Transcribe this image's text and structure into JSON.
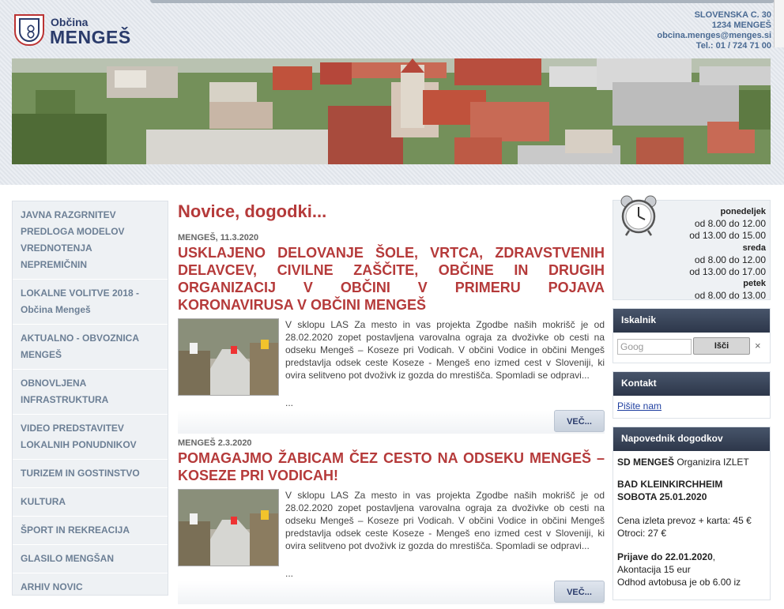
{
  "header": {
    "logo_small": "Občina",
    "logo_big": "MENGEŠ",
    "address_line1": "SLOVENSKA C. 30",
    "address_line2": "1234 MENGEŠ",
    "email": "obcina.menges@menges.si",
    "phone": "Tel.: 01 / 724 71 00"
  },
  "sidebar": {
    "items": [
      {
        "label": "JAVNA RAZGRNITEV PREDLOGA MODELOV VREDNOTENJA NEPREMIČNIN"
      },
      {
        "label": "LOKALNE VOLITVE 2018 - Občina Mengeš"
      },
      {
        "label": "AKTUALNO - OBVOZNICA MENGEŠ"
      },
      {
        "label": "OBNOVLJENA INFRASTRUKTURA"
      },
      {
        "label": "VIDEO PREDSTAVITEV LOKALNIH PONUDNIKOV"
      },
      {
        "label": "TURIZEM IN GOSTINSTVO"
      },
      {
        "label": "KULTURA"
      },
      {
        "label": "ŠPORT IN REKREACIJA"
      },
      {
        "label": "GLASILO MENGŠAN"
      },
      {
        "label": "ARHIV NOVIC"
      }
    ]
  },
  "main": {
    "section_title": "Novice, dogodki...",
    "news": [
      {
        "meta": "MENGEŠ, 11.3.2020",
        "title": "USKLAJENO DELOVANJE ŠOLE, VRTCA, ZDRAVSTVENIH DELAVCEV, CIVILNE ZAŠČITE, OBČINE IN DRUGIH ORGANIZACIJ V OBČINI V PRIMERU POJAVA KORONAVIRUSA V OBČINI MENGEŠ",
        "text": "V sklopu LAS Za mesto in vas projekta Zgodbe naših mokrišč je od 28.02.2020 zopet postavljena varovalna ograja za dvoživke ob cesti na odseku Mengeš – Koseze pri Vodicah. V občini Vodice in občini Mengeš predstavlja odsek ceste Koseze - Mengeš eno izmed cest v Sloveniji, ki ovira selitveno pot dvoživk iz gozda do mrestišča. Spomladi se odpravi...",
        "ellipsis": "...",
        "more": "VEČ..."
      },
      {
        "meta": "MENGEŠ 2.3.2020",
        "title": "POMAGAJMO ŽABICAM ČEZ CESTO NA ODSEKU MENGEŠ – KOSEZE PRI VODICAH!",
        "text": "V sklopu LAS Za mesto in vas projekta Zgodbe naših mokrišč je od 28.02.2020 zopet postavljena varovalna ograja za dvoživke ob cesti na odseku Mengeš – Koseze pri Vodicah. V občini Vodice in občini Mengeš predstavlja odsek ceste Koseze - Mengeš eno izmed cest v Sloveniji, ki ovira selitveno pot dvoživk iz gozda do mrestišča. Spomladi se odpravi...",
        "ellipsis": "...",
        "more": "VEČ..."
      }
    ]
  },
  "hours": {
    "days": [
      {
        "day": "ponedeljek",
        "slots": [
          "od 8.00 do 12.00",
          "od 13.00 do 15.00"
        ]
      },
      {
        "day": "sreda",
        "slots": [
          "od 8.00 do 12.00",
          "od 13.00 do 17.00"
        ]
      },
      {
        "day": "petek",
        "slots": [
          "od 8.00 do 13.00"
        ]
      }
    ]
  },
  "search": {
    "title": "Iskalnik",
    "placeholder": "Google",
    "value": "Goog",
    "button": "Išči",
    "clear": "×"
  },
  "contact_box": {
    "title": "Kontakt",
    "link": "Pišite nam"
  },
  "events": {
    "title": "Napovednik dogodkov",
    "line1_bold": "SD MENGEŠ",
    "line1_rest": " Organizira IZLET",
    "line2": "BAD KLEINKIRCHHEIM",
    "line3": "SOBOTA 25.01.2020",
    "price1": "Cena izleta prevoz + karta: 45 €",
    "price2": "Otroci: 27 €",
    "reg_bold": "Prijave do 22.01.2020",
    "reg_rest": ",",
    "deposit": "Akontacija 15 eur",
    "departure": "Odhod avtobusa je ob 6.00 iz"
  },
  "colors": {
    "accent": "#b53a3a",
    "brand": "#2a3b6b",
    "nav_text": "#6c7f95"
  }
}
